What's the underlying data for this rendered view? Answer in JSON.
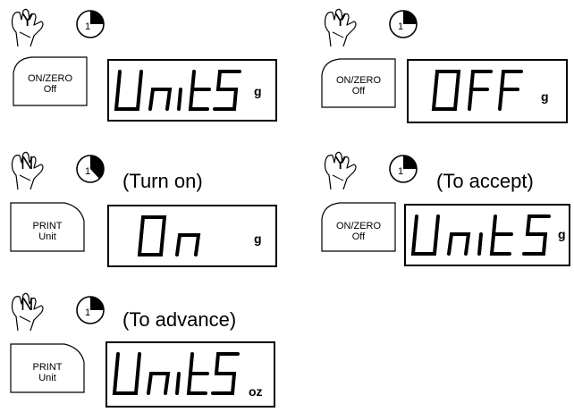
{
  "steps": [
    {
      "answer": "Y",
      "timer_value": "1",
      "caption": "",
      "key": {
        "line1": "ON/ZERO",
        "line2": "Off"
      },
      "display": {
        "text": "UnitS",
        "unit": "g"
      }
    },
    {
      "answer": "Y",
      "timer_value": "1",
      "caption": "",
      "key": {
        "line1": "ON/ZERO",
        "line2": "Off"
      },
      "display": {
        "text": "OFF",
        "unit": "g"
      }
    },
    {
      "answer": "N",
      "timer_value": "1",
      "caption": "(Turn on)",
      "key": {
        "line1": "PRINT",
        "line2": "Unit"
      },
      "display": {
        "text": "On",
        "unit": "g"
      }
    },
    {
      "answer": "Y",
      "timer_value": "1",
      "caption": "(To accept)",
      "key": {
        "line1": "ON/ZERO",
        "line2": "Off"
      },
      "display": {
        "text": "UnitS",
        "unit": "g"
      }
    },
    {
      "answer": "N",
      "timer_value": "1",
      "caption": "(To advance)",
      "key": {
        "line1": "PRINT",
        "line2": "Unit"
      },
      "display": {
        "text": "UnitS",
        "unit": "oz"
      }
    }
  ]
}
